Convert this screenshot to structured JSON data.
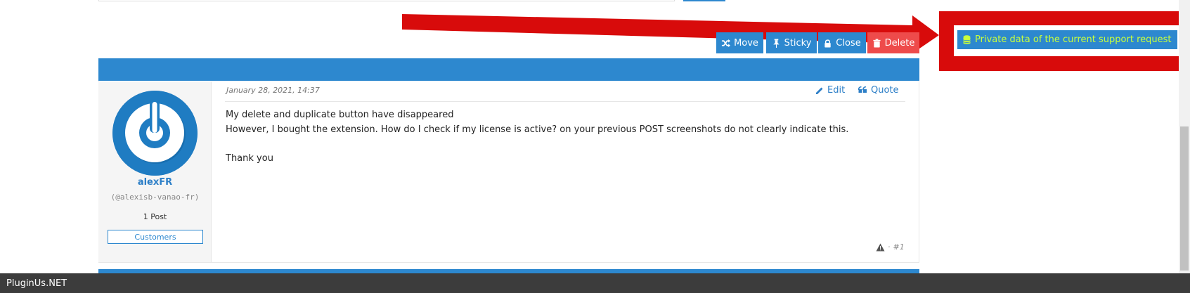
{
  "annotation": {
    "private_button_label": "Private data of the current support request",
    "colors": {
      "frame": "#d80b0b",
      "button_bg": "#2d88cf",
      "button_text": "#c8ff3c"
    },
    "icon": "database-icon"
  },
  "moderation": {
    "buttons": [
      {
        "label": "Move",
        "icon": "shuffle-icon"
      },
      {
        "label": "Sticky",
        "icon": "pin-icon"
      },
      {
        "label": "Close",
        "icon": "lock-icon"
      },
      {
        "label": "Delete",
        "icon": "trash-icon"
      }
    ]
  },
  "post": {
    "date": "January 28, 2021, 14:37",
    "actions": {
      "edit": "Edit",
      "quote": "Quote"
    },
    "author": {
      "name": "alexFR",
      "handle": "(@alexisb-vanao-fr)",
      "post_count": "1 Post",
      "group": "Customers"
    },
    "body": [
      "My delete and duplicate button have disappeared",
      "However, I bought the extension. How do I check if my license is active? on your previous POST screenshots do not clearly indicate this.",
      "Thank you"
    ],
    "footer": {
      "separator": "·",
      "number": "#1"
    }
  },
  "footer_bar": {
    "site_name": "PluginUs.NET"
  },
  "colors": {
    "accent": "#2d88cf",
    "delete": "#ee4b4b"
  }
}
